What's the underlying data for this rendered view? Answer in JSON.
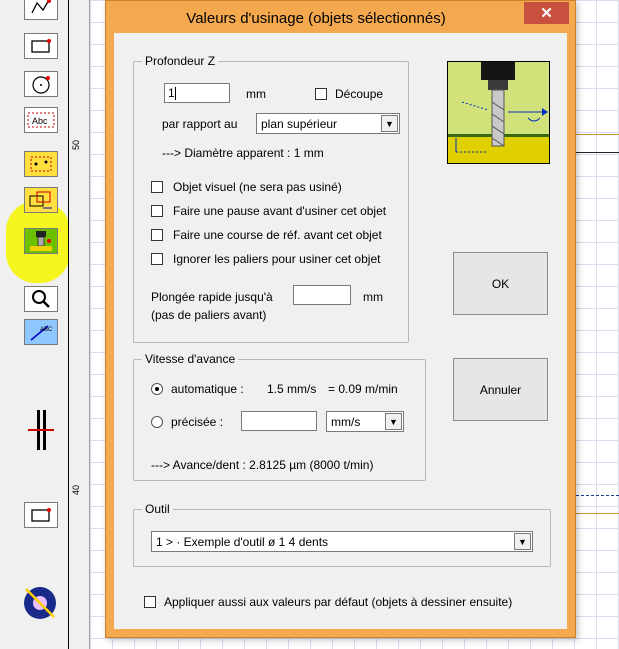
{
  "dialog": {
    "title": "Valeurs d'usinage (objets sélectionnés)",
    "close_glyph": "✕",
    "ok_label": "OK",
    "cancel_label": "Annuler"
  },
  "profondeur": {
    "group_title": "Profondeur Z",
    "value": "1",
    "unit": "mm",
    "decoupe_label": "Découpe",
    "decoupe_checked": false,
    "par_rapport_label": "par rapport au",
    "par_rapport_value": "plan supérieur",
    "diametre_text": "---> Diamètre apparent : 1 mm"
  },
  "options": [
    {
      "label": "Objet visuel  (ne sera pas usiné)",
      "checked": false
    },
    {
      "label": "Faire une pause avant d'usiner cet objet",
      "checked": false
    },
    {
      "label": "Faire une course de réf. avant cet objet",
      "checked": false
    },
    {
      "label": "Ignorer les paliers pour usiner cet objet",
      "checked": false
    }
  ],
  "plongee": {
    "label_line1": "Plongée rapide jusqu'à",
    "label_line2": "(pas de paliers avant)",
    "value": "",
    "unit": "mm"
  },
  "vitesse": {
    "group_title": "Vitesse d'avance",
    "auto_label": "automatique :",
    "auto_value": "1.5 mm/s",
    "auto_equiv": "= 0.09 m/min",
    "precisee_label": "précisée :",
    "precisee_value": "",
    "unit_value": "mm/s",
    "avance_text": "---> Avance/dent :  2.8125 µm  (8000 t/min)",
    "selected": "automatique"
  },
  "outil": {
    "group_title": "Outil",
    "selected": "1 > · Exemple d'outil   ø 1   4 dents"
  },
  "appliquer_label": "Appliquer aussi aux valeurs par défaut  (objets à dessiner ensuite)",
  "ruler": {
    "label_top": "50",
    "label_bottom": "40"
  },
  "toolbar_icons": [
    "polyline-icon",
    "rectangle-icon",
    "circle-icon",
    "text-icon",
    "select-points-icon",
    "copy-resize-icon",
    "machining-values-icon",
    "zoom-icon",
    "text-path-icon",
    "split-view-icon",
    "new-frame-icon",
    "engrave-icon"
  ],
  "colors": {
    "accent": "#f4a94f",
    "close": "#c7503f",
    "highlight": "#f5f51f"
  }
}
